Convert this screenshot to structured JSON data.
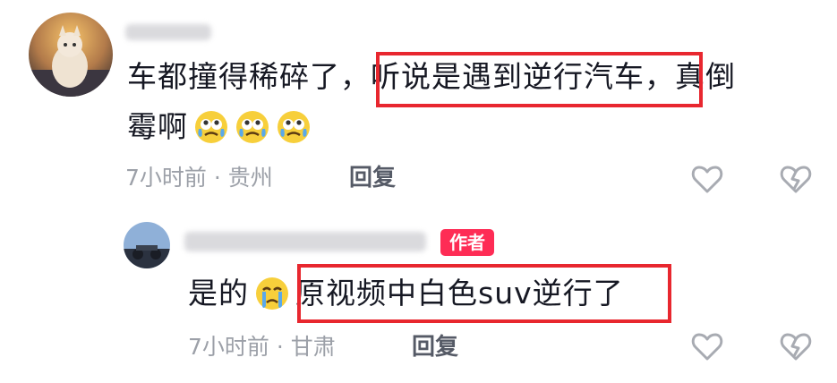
{
  "comments": [
    {
      "text_line1": "车都撞得稀碎了，听说是遇到逆行汽车，真倒",
      "text_line2": "霉啊",
      "emoji_count": 3,
      "time": "7小时前",
      "separator": "·",
      "location": "贵州",
      "reply_label": "回复"
    },
    {
      "author_badge": "作者",
      "text_prefix": "是的",
      "text_highlight": "原视频中白色suv逆行了",
      "time": "7小时前",
      "separator": "·",
      "location": "甘肃",
      "reply_label": "回复"
    }
  ],
  "icons": {
    "like": "heart-outline-icon",
    "dislike": "broken-heart-icon",
    "emoji": "crying-face-emoji"
  },
  "colors": {
    "highlight_border": "#e8272f",
    "author_badge_bg": "#fe2c55",
    "meta_text": "#9ca0a8",
    "reply_text": "#555a66",
    "icon_stroke": "#a8abb2"
  }
}
